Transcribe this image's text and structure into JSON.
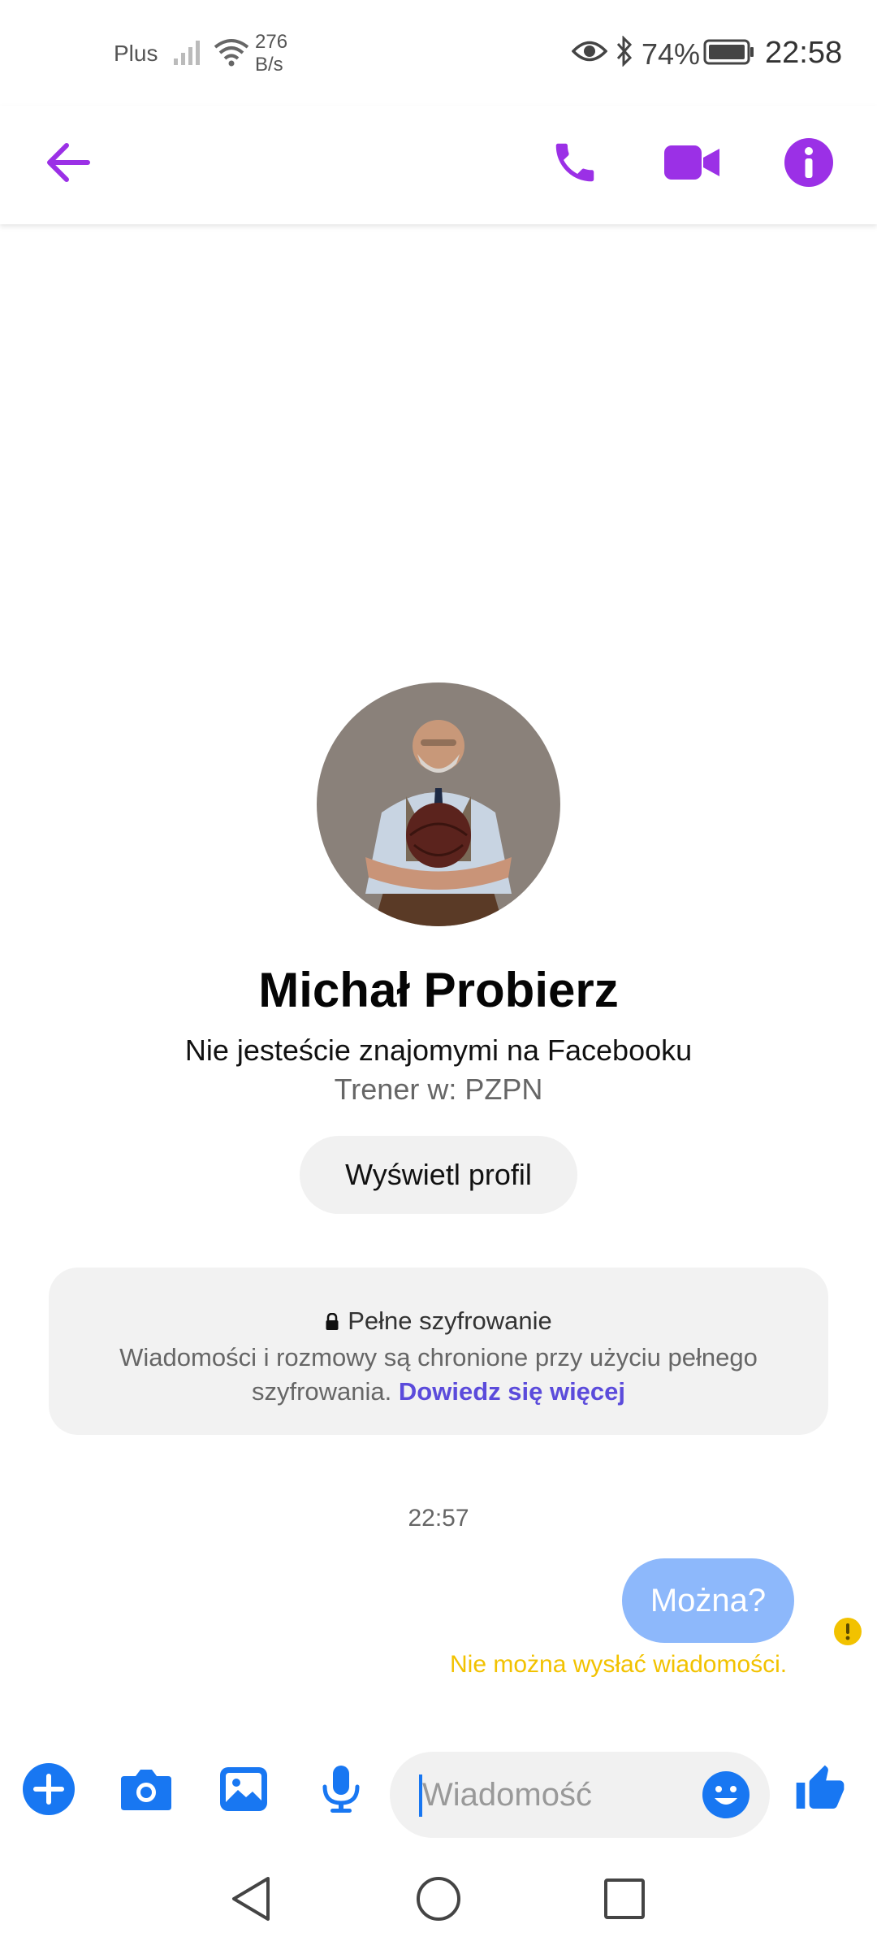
{
  "status_bar": {
    "carrier": "Plus",
    "net_speed_value": "276",
    "net_speed_unit": "B/s",
    "battery_percent": "74%",
    "time": "22:58"
  },
  "header": {
    "accent_color": "#9b30e6",
    "icons": [
      "back-arrow-icon",
      "phone-icon",
      "video-camera-icon",
      "info-icon"
    ]
  },
  "profile": {
    "name": "Michał Probierz",
    "friend_status": "Nie jesteście znajomymi na Facebooku",
    "work": "Trener w: PZPN",
    "view_profile_label": "Wyświetl profil"
  },
  "encryption": {
    "title": "Pełne szyfrowanie",
    "body": "Wiadomości i rozmowy są chronione przy użyciu pełnego szyfrowania.",
    "link": "Dowiedz się więcej",
    "link_color": "#5b4bdb"
  },
  "conversation": {
    "timestamp": "22:57",
    "messages": [
      {
        "text": "Można?",
        "from_me": true,
        "status": "failed"
      }
    ],
    "error_text": "Nie można wysłać wiadomości.",
    "bubble_color": "#8db8fb",
    "error_color": "#f2c200"
  },
  "composer": {
    "placeholder": "Wiadomość",
    "accent_color": "#1877f2",
    "icons": [
      "plus-icon",
      "camera-icon",
      "gallery-icon",
      "microphone-icon",
      "emoji-icon",
      "thumbs-up-icon"
    ]
  },
  "nav_bar": {
    "icons": [
      "back-triangle-icon",
      "home-circle-icon",
      "recents-square-icon"
    ]
  }
}
